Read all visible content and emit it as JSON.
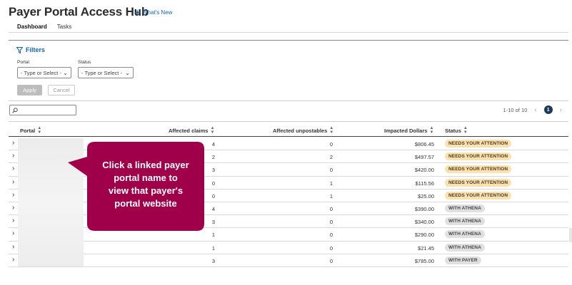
{
  "header": {
    "title": "Payer Portal Access Hub",
    "whats_new": "What's New",
    "tabs": [
      {
        "label": "Dashboard",
        "active": true
      },
      {
        "label": "Tasks",
        "active": false
      }
    ]
  },
  "filters": {
    "toggle_label": "Filters",
    "portal": {
      "label": "Portal",
      "value": "- Type or Select -"
    },
    "status": {
      "label": "Status",
      "value": "- Type or Select -"
    },
    "apply_label": "Apply",
    "cancel_label": "Cancel"
  },
  "search": {
    "placeholder": ""
  },
  "pagination": {
    "range": "1-10 of 10",
    "current_page": "1"
  },
  "table": {
    "columns": [
      "Portal",
      "Affected claims",
      "Affected unpostables",
      "Impacted Dollars",
      "Status"
    ],
    "rows": [
      {
        "claims": "4",
        "unpostables": "0",
        "dollars": "$806.45",
        "status": "NEEDS YOUR ATTENTION"
      },
      {
        "claims": "2",
        "unpostables": "2",
        "dollars": "$497.57",
        "status": "NEEDS YOUR ATTENTION"
      },
      {
        "claims": "3",
        "unpostables": "0",
        "dollars": "$420.00",
        "status": "NEEDS YOUR ATTENTION"
      },
      {
        "claims": "0",
        "unpostables": "1",
        "dollars": "$115.56",
        "status": "NEEDS YOUR ATTENTION"
      },
      {
        "claims": "0",
        "unpostables": "1",
        "dollars": "$25.00",
        "status": "NEEDS YOUR ATTENTION"
      },
      {
        "claims": "4",
        "unpostables": "0",
        "dollars": "$390.00",
        "status": "WITH ATHENA"
      },
      {
        "claims": "3",
        "unpostables": "0",
        "dollars": "$340.00",
        "status": "WITH ATHENA"
      },
      {
        "claims": "1",
        "unpostables": "0",
        "dollars": "$290.00",
        "status": "WITH ATHENA"
      },
      {
        "claims": "1",
        "unpostables": "0",
        "dollars": "$21.45",
        "status": "WITH ATHENA"
      },
      {
        "claims": "3",
        "unpostables": "0",
        "dollars": "$785.00",
        "status": "WITH PAYER"
      }
    ]
  },
  "callout": {
    "lines": [
      "Click a linked payer",
      "portal name to",
      "view that payer's",
      "portal website"
    ],
    "color": "#a0004a"
  },
  "colors": {
    "accent": "#1566a8",
    "attention_badge": "#fbe1b0",
    "neutral_badge": "#e0e0e0",
    "page_badge": "#1b3a5a"
  },
  "icons": {
    "whats_new": "sparkle-icon",
    "filters": "filter-funnel-icon",
    "search": "search-icon",
    "sort": "sort-arrows-icon",
    "expand": "chevron-right-icon",
    "prev": "chevron-left-icon",
    "next": "chevron-right-icon"
  }
}
